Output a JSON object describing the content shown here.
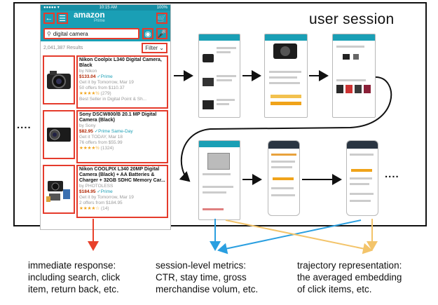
{
  "session_label": "user session",
  "ellipsis": "....",
  "phone": {
    "status": {
      "carrier": "●●●●● ▾",
      "time": "10:15 AM",
      "battery": "100%"
    },
    "brand": "amazon",
    "brand_sub": "Prime",
    "search_value": "digital camera",
    "results_count": "2,041,387 Results",
    "filter_label": "Filter",
    "products": [
      {
        "title": "Nikon Coolpix L340 Digital Camera, Black",
        "by": "by Nikon",
        "price": "$133.04",
        "prime": "✓Prime",
        "delivery": "Get it by Tomorrow, Mar 19",
        "offers": "50 offers from $110.37",
        "stars": "★★★★½",
        "reviews": "(279)",
        "extra": "Best Seller  in Digital Point & Sh..."
      },
      {
        "title": "Sony DSCW800/B 20.1 MP Digital Camera (Black)",
        "by": "by Sony",
        "price": "$82.95",
        "prime": "✓Prime Same-Day",
        "delivery": "Get it TODAY, Mar 18",
        "offers": "76 offers from $55.99",
        "stars": "★★★★½",
        "reviews": "(1324)",
        "extra": ""
      },
      {
        "title": "Nikon COOLPIX L340 20MP Digital Camera (Black) + AA Batteries & Charger + 32GB SDHC Memory Car...",
        "by": "by PHOTOLESS",
        "price": "$184.95",
        "prime": "✓Prime",
        "delivery": "Get it by Tomorrow, Mar 19",
        "offers": "2 offers from $184.95",
        "stars": "★★★★☆",
        "reviews": "(14)",
        "extra": ""
      }
    ]
  },
  "captions": [
    {
      "lines": [
        "immediate response:",
        "including search, click",
        "item, return back, etc."
      ]
    },
    {
      "lines": [
        "session-level metrics:",
        "CTR, stay time, gross",
        "merchandise volum, etc."
      ]
    },
    {
      "lines": [
        "trajectory representation:",
        "the averaged embedding",
        "of click items, etc."
      ]
    }
  ],
  "colors": {
    "highlight": "#e53b2c",
    "arrow_orange": "#e8402a",
    "arrow_blue": "#2a9fe0",
    "arrow_yellow": "#f3c46a",
    "app_teal": "#1a9fb5"
  }
}
